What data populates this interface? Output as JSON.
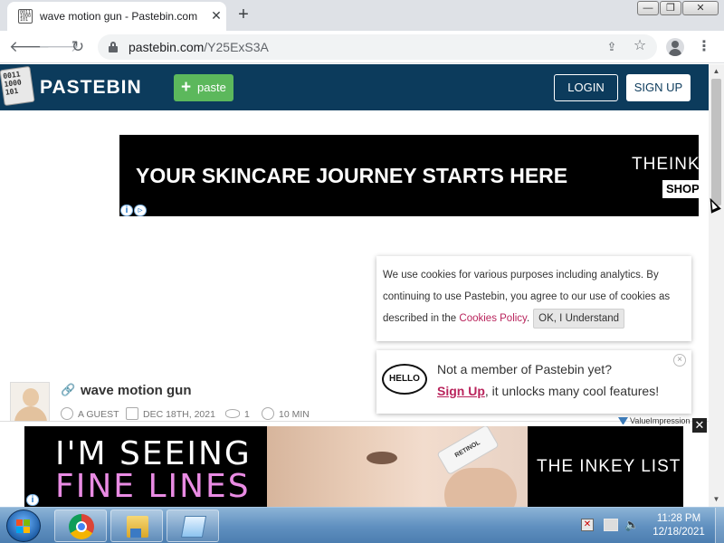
{
  "browser": {
    "tab_title": "wave motion gun - Pastebin.com",
    "tab_close": "✕",
    "new_tab": "+",
    "favicon_text": "0011 1000 101",
    "url_host": "pastebin.com",
    "url_path": "/Y25ExS3A",
    "window_controls": {
      "minimize": "—",
      "maximize": "❐",
      "close": "✕"
    },
    "icons": [
      "back-arrow-icon",
      "forward-arrow-icon",
      "reload-icon",
      "lock-icon",
      "share-icon",
      "star-icon",
      "profile-icon",
      "menu-icon"
    ]
  },
  "site": {
    "logo_text": "PASTEBIN",
    "logo_mark": "0011\n1000\n101",
    "paste_button": "paste",
    "login_button": "LOGIN",
    "signup_button": "SIGN UP",
    "header_color": "#0c3b5c",
    "accent_green": "#5cb85c"
  },
  "top_ad": {
    "headline": "YOUR SKINCARE JOURNEY STARTS HERE",
    "brand": "THEINK",
    "cta": "SHOP"
  },
  "cookie_notice": {
    "text": "We use cookies for various purposes including analytics. By continuing to use Pastebin, you agree to our use of cookies as described in the ",
    "link": "Cookies Policy",
    "after_link": ".",
    "ok_button": "OK, I Understand"
  },
  "member_notice": {
    "hello_badge": "HELLO",
    "title": "Not a member of Pastebin yet?",
    "signup_link": "Sign Up",
    "subtitle_rest": ", it unlocks many cool features!",
    "close": "×"
  },
  "paste": {
    "title": "wave motion gun",
    "author": "A GUEST",
    "date": "DEC 18TH, 2021",
    "views": "1",
    "expiry": "10 MIN"
  },
  "bottom_ad": {
    "line1": "I'M SEEING",
    "line2": "FINE LINES",
    "brand": "THE INKEY LIST",
    "bottle_label": "RETINOL",
    "network_label": "ValueImpression",
    "close": "✕"
  },
  "taskbar": {
    "clock_time": "11:28 PM",
    "clock_date": "12/18/2021",
    "pinned": [
      "chrome-icon",
      "explorer-folder-icon",
      "notepad-icon"
    ]
  }
}
